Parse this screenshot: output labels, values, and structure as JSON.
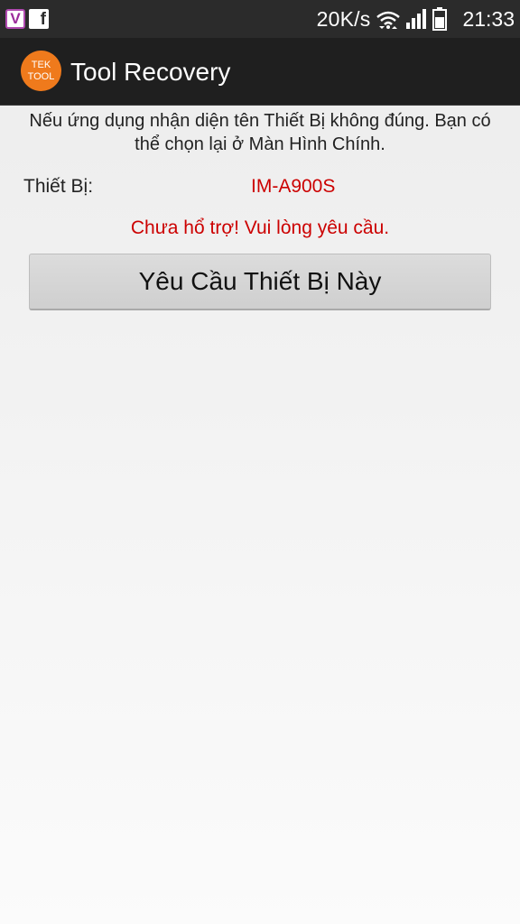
{
  "status_bar": {
    "notifications": [
      {
        "name": "viber-notification-icon",
        "glyph": "V",
        "color": "#9b2b9b"
      },
      {
        "name": "facebook-notification-icon",
        "glyph": "f"
      }
    ],
    "net_speed": "20K/s",
    "time": "21:33",
    "icons": [
      "wifi-icon",
      "signal-icon",
      "battery-icon"
    ]
  },
  "action_bar": {
    "logo_line1": "TEK",
    "logo_line2": "TOOL",
    "logo_color": "#ef7a1c",
    "title": "Tool Recovery"
  },
  "main": {
    "info_line1": "Nếu ứng dụng nhận diện tên Thiết Bị không đúng. Bạn có",
    "info_line2": "thể chọn lại ở Màn Hình Chính.",
    "device_label": "Thiết Bị:",
    "device_value": "IM-A900S",
    "warning": "Chưa hổ trợ! Vui lòng yêu cầu.",
    "request_button_label": "Yêu Cầu Thiết Bị Này",
    "accent_color": "#cc0000"
  }
}
